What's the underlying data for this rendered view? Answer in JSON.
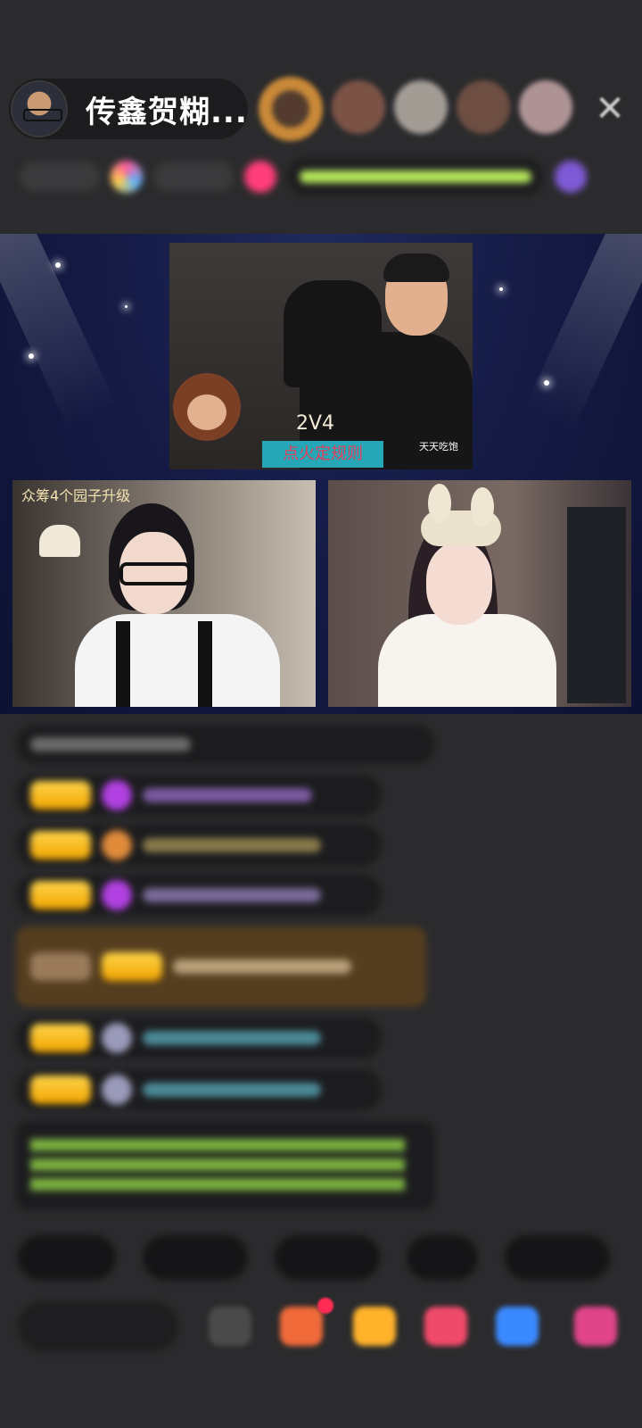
{
  "header": {
    "host_name": "传鑫贺糊...",
    "close_glyph": "✕"
  },
  "stage": {
    "main_score": "2V4",
    "main_banner": "点火定规则",
    "main_tag": "天天吃饱",
    "left_title": "众筹4个园子升级"
  },
  "colors": {
    "badge_gold": "#f5b800",
    "username_purple": "#b68df0",
    "username_cyan": "#5cc6d6",
    "stage_bg": "#141a44"
  },
  "icons": [
    "avatar",
    "close-icon",
    "gift-icon",
    "gem-icon",
    "game-icon"
  ]
}
